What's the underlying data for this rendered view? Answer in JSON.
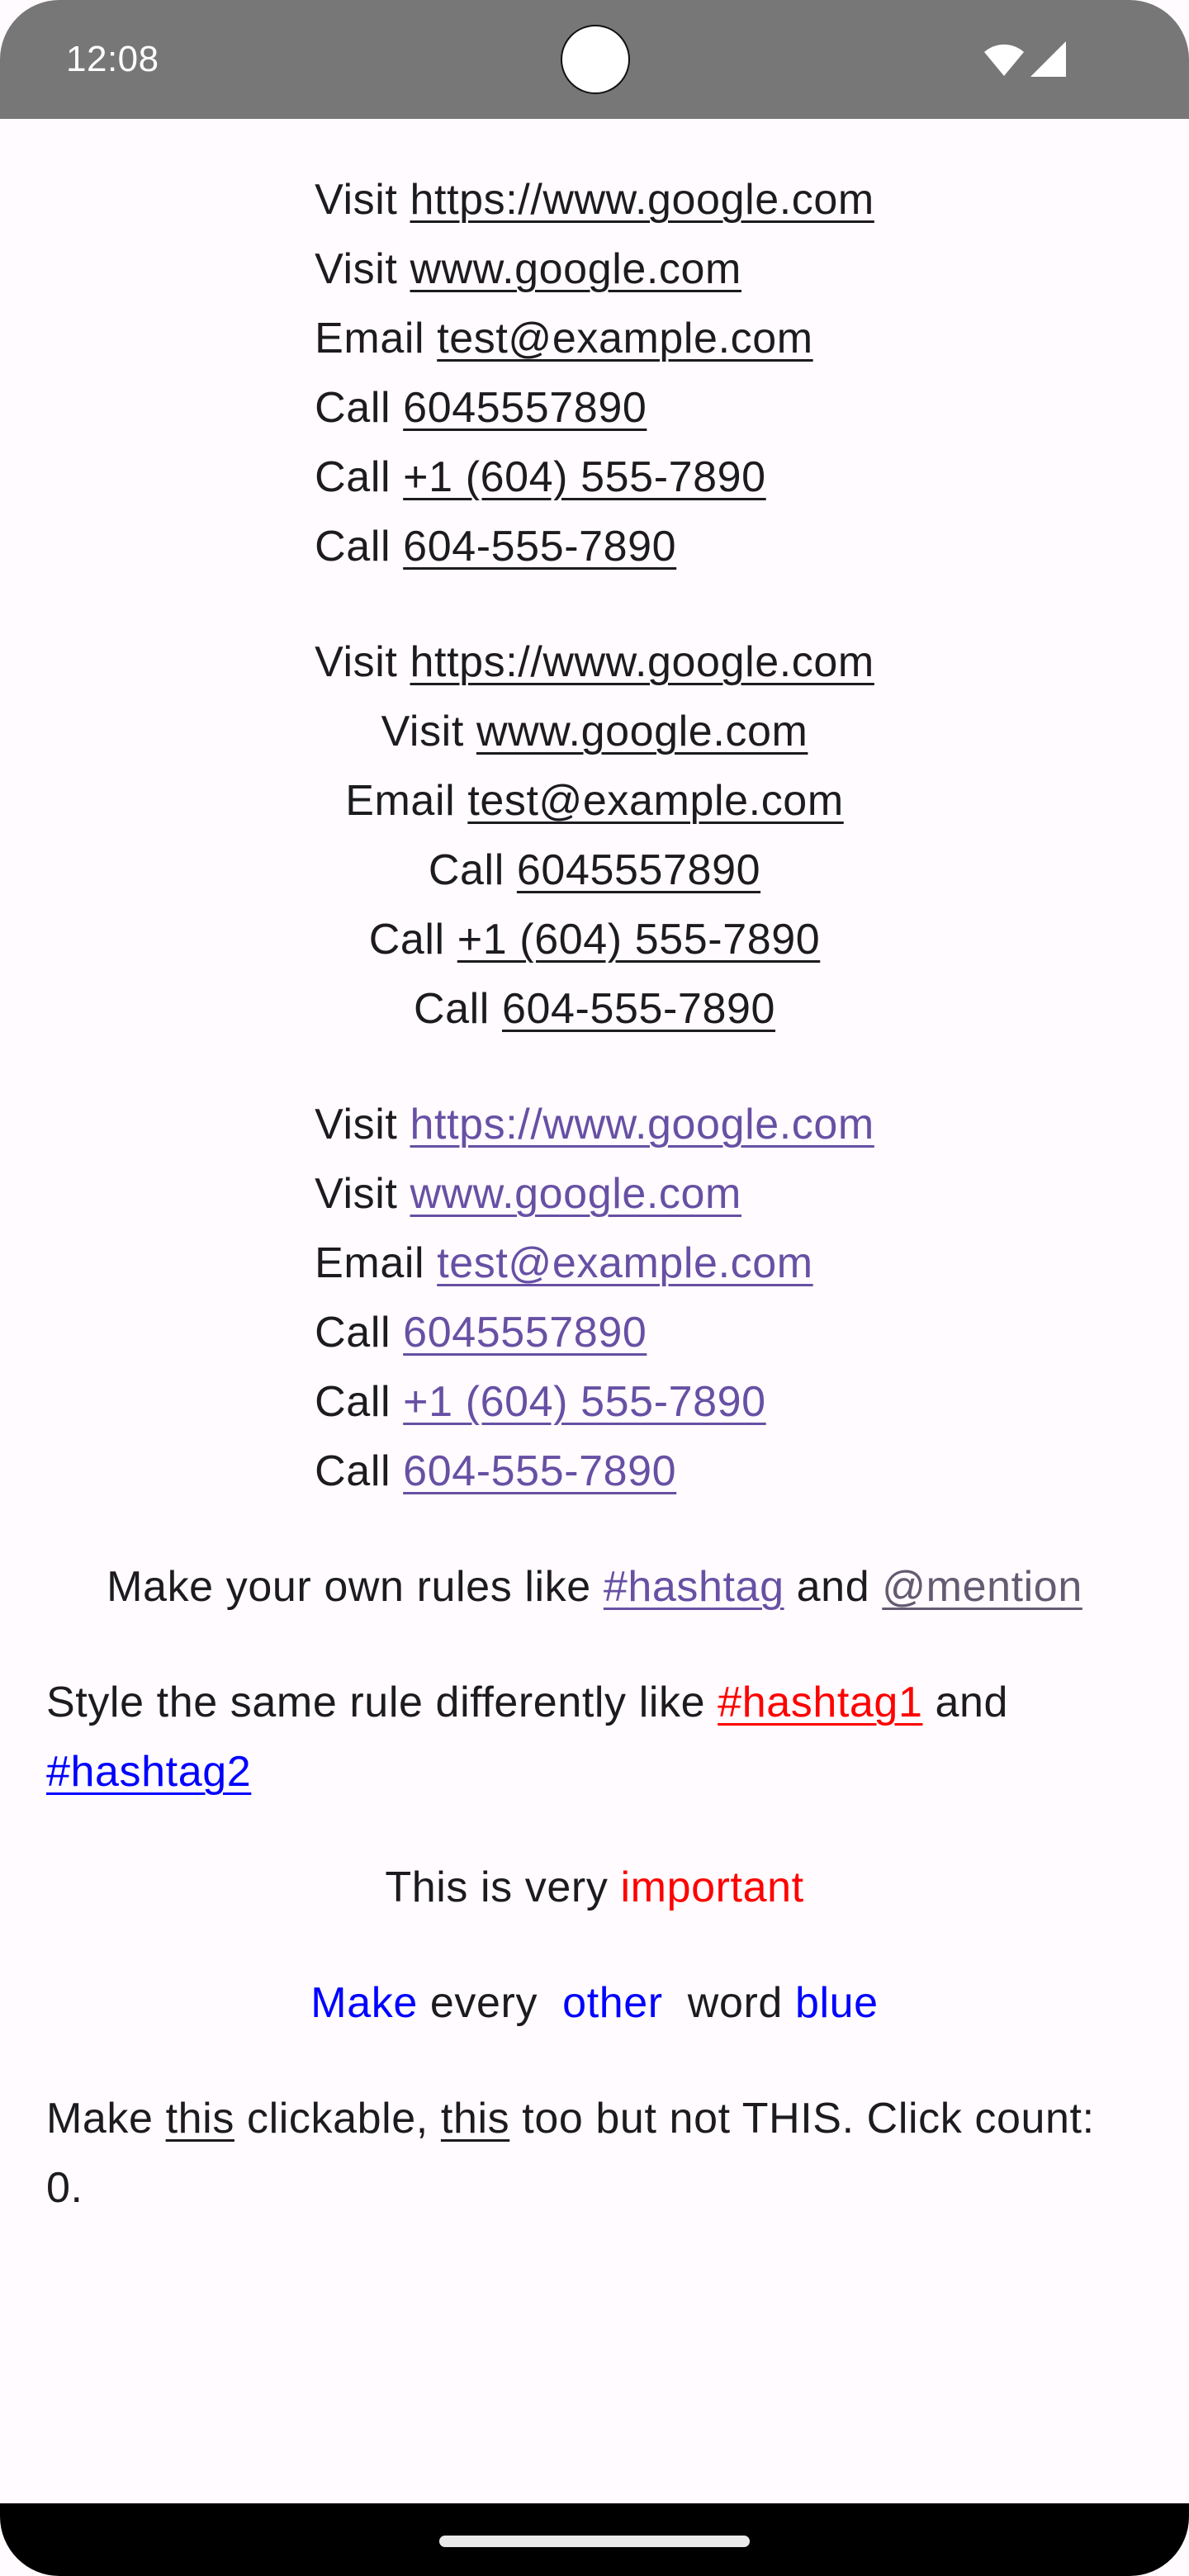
{
  "status_bar": {
    "time": "12:08",
    "icons": [
      "wifi-icon",
      "signal-icon"
    ]
  },
  "colors": {
    "background": "#FFFBFE",
    "text": "#1C1B1F",
    "link_primary": "#6750A4",
    "link_secondary": "#625B71",
    "red": "#FF0000",
    "blue": "#0000FF"
  },
  "block1": {
    "alignment": "left",
    "lines": [
      {
        "prefix": "Visit ",
        "link": "https://www.google.com"
      },
      {
        "prefix": "Visit ",
        "link": "www.google.com"
      },
      {
        "prefix": "Email ",
        "link": "test@example.com"
      },
      {
        "prefix": "Call ",
        "link": "6045557890"
      },
      {
        "prefix": "Call ",
        "link": "+1 (604) 555-7890"
      },
      {
        "prefix": "Call ",
        "link": "604-555-7890"
      }
    ]
  },
  "block2": {
    "alignment": "center",
    "lines": [
      {
        "prefix": "Visit ",
        "link": "https://www.google.com"
      },
      {
        "prefix": "Visit ",
        "link": "www.google.com"
      },
      {
        "prefix": "Email ",
        "link": "test@example.com"
      },
      {
        "prefix": "Call ",
        "link": "6045557890"
      },
      {
        "prefix": "Call ",
        "link": "+1 (604) 555-7890"
      },
      {
        "prefix": "Call ",
        "link": "604-555-7890"
      }
    ]
  },
  "block3": {
    "alignment": "left",
    "link_color": "#6750A4",
    "lines": [
      {
        "prefix": "Visit ",
        "link": "https://www.google.com"
      },
      {
        "prefix": "Visit ",
        "link": "www.google.com"
      },
      {
        "prefix": "Email ",
        "link": "test@example.com"
      },
      {
        "prefix": "Call ",
        "link": "6045557890"
      },
      {
        "prefix": "Call ",
        "link": "+1 (604) 555-7890"
      },
      {
        "prefix": "Call ",
        "link": "604-555-7890"
      }
    ]
  },
  "custom_rules": {
    "prefix": "Make your own rules like ",
    "hashtag": "#hashtag",
    "middle": " and ",
    "mention": "@mention"
  },
  "styled_rules": {
    "prefix": "Style the same rule differently like ",
    "hashtag1": "#hashtag1",
    "middle": " and ",
    "hashtag2": "#hashtag2"
  },
  "important": {
    "prefix": "This is very ",
    "highlight": "important"
  },
  "every_other": {
    "words": [
      "Make",
      " every  ",
      "other",
      "  word ",
      "blue"
    ]
  },
  "clickable": {
    "part1": "Make ",
    "link1": "this",
    "part2": " clickable, ",
    "link2": "this",
    "part3": " too but not THIS. Click count: ",
    "count": "0",
    "part4": "."
  }
}
